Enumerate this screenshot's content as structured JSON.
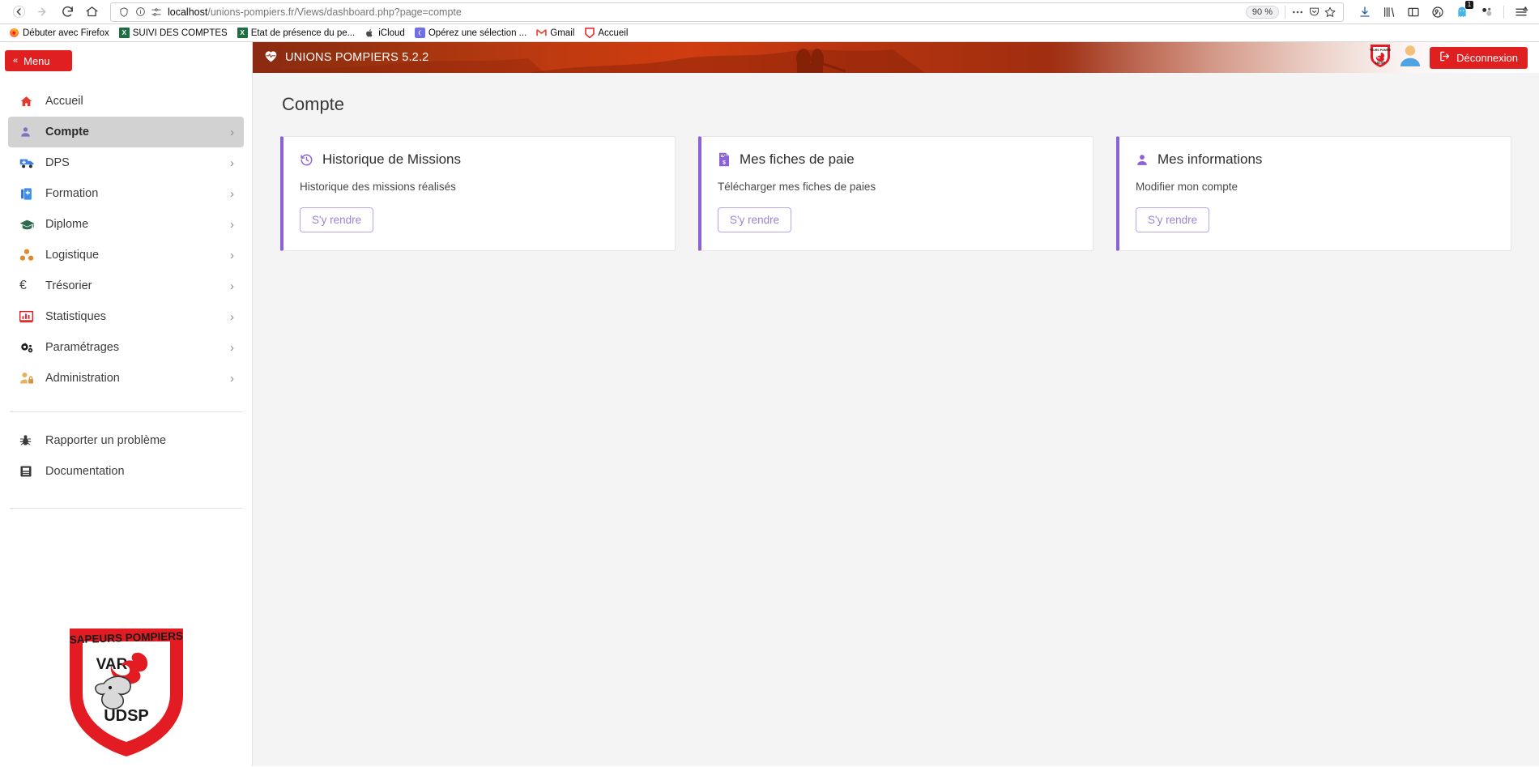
{
  "browser": {
    "nav": {
      "back_icon": "back-arrow-icon",
      "forward_icon": "forward-arrow-icon",
      "reload_icon": "reload-icon",
      "home_icon": "home-icon"
    },
    "url": {
      "host": "localhost",
      "path": "/unions-pompiers.fr/Views/dashboard.php?page=compte",
      "full": "localhost/unions-pompiers.fr/Views/dashboard.php?page=compte",
      "shield_icon": "tracking-protection-shield-icon",
      "info_icon": "page-info-icon",
      "permissions_icon": "site-permissions-icon"
    },
    "zoom_level": "90 %",
    "toolbar_right": [
      {
        "name": "page-actions-icon",
        "glyph": "•••"
      },
      {
        "name": "pocket-icon",
        "glyph": "pocket"
      },
      {
        "name": "bookmark-star-icon",
        "glyph": "☆"
      }
    ],
    "toolbar_far_right": [
      {
        "name": "downloads-icon",
        "glyph": "download"
      },
      {
        "name": "library-icon",
        "glyph": "library"
      },
      {
        "name": "sidebars-icon",
        "glyph": "sidebar"
      },
      {
        "name": "account-icon",
        "glyph": "account"
      },
      {
        "name": "ghostery-icon",
        "glyph": "ghost",
        "badge": "1"
      },
      {
        "name": "extension-icon",
        "glyph": "molecule"
      },
      {
        "name": "app-menu-icon",
        "glyph": "hamburger"
      }
    ],
    "bookmarks": [
      {
        "label": "Débuter avec Firefox",
        "icon": "firefox-icon"
      },
      {
        "label": "SUIVI DES COMPTES",
        "icon": "excel-icon"
      },
      {
        "label": "Etat de présence du pe...",
        "icon": "excel-icon"
      },
      {
        "label": "iCloud",
        "icon": "apple-icon"
      },
      {
        "label": "Opérez une sélection ...",
        "icon": "moon-icon"
      },
      {
        "label": "Gmail",
        "icon": "gmail-icon"
      },
      {
        "label": "Accueil",
        "icon": "pompiers-icon"
      }
    ]
  },
  "sidebar": {
    "menu_toggle": {
      "label": "Menu",
      "icon": "double-chevron-left-icon"
    },
    "items": [
      {
        "label": "Accueil",
        "icon": "home-icon",
        "chevron": false,
        "active": false
      },
      {
        "label": "Compte",
        "icon": "user-icon",
        "chevron": true,
        "active": true
      },
      {
        "label": "DPS",
        "icon": "ambulance-icon",
        "chevron": true,
        "active": false
      },
      {
        "label": "Formation",
        "icon": "hospital-icon",
        "chevron": true,
        "active": false
      },
      {
        "label": "Diplome",
        "icon": "graduation-cap-icon",
        "chevron": true,
        "active": false
      },
      {
        "label": "Logistique",
        "icon": "boxes-icon",
        "chevron": true,
        "active": false
      },
      {
        "label": "Trésorier",
        "icon": "euro-icon",
        "chevron": true,
        "active": false
      },
      {
        "label": "Statistiques",
        "icon": "bar-chart-icon",
        "chevron": true,
        "active": false
      },
      {
        "label": "Paramétrages",
        "icon": "gears-icon",
        "chevron": true,
        "active": false
      },
      {
        "label": "Administration",
        "icon": "user-lock-icon",
        "chevron": true,
        "active": false
      }
    ],
    "footer_items": [
      {
        "label": "Rapporter un problème",
        "icon": "bug-icon"
      },
      {
        "label": "Documentation",
        "icon": "book-icon"
      }
    ],
    "logo": {
      "name": "udsp-var-sapeurs-pompiers-logo",
      "top_text": "SAPEURS   POMPIERS",
      "mid_text": "VAR",
      "bottom_text": "UDSP"
    }
  },
  "header": {
    "title": "UNIONS POMPIERS 5.2.2",
    "title_icon": "heartbeat-icon",
    "shield_badge_icon": "pompiers-shield-icon",
    "avatar_icon": "user-avatar-icon",
    "logout": {
      "label": "Déconnexion",
      "icon": "sign-out-icon"
    },
    "accent_color": "#e02020",
    "banner_color": "#b8330f"
  },
  "main": {
    "page_title": "Compte",
    "accent_color": "#8b63d6",
    "cards": [
      {
        "title": "Historique de Missions",
        "icon": "history-clock-icon",
        "description": "Historique des missions réalisés",
        "button": "S'y rendre"
      },
      {
        "title": "Mes fiches de paie",
        "icon": "payslip-file-icon",
        "description": "Télécharger mes fiches de paies",
        "button": "S'y rendre"
      },
      {
        "title": "Mes informations",
        "icon": "user-icon",
        "description": "Modifier mon compte",
        "button": "S'y rendre"
      }
    ]
  }
}
